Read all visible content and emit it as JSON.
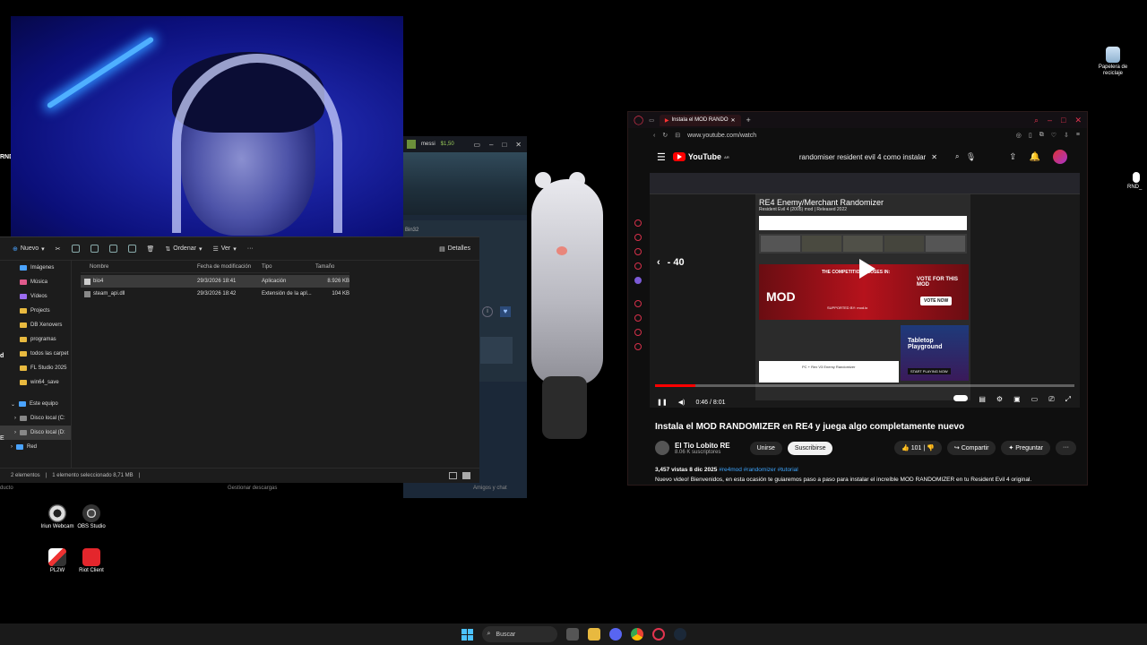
{
  "desktop": {
    "recycle_bin": "Papelera de reciclaje",
    "rnd_label": "RND_",
    "icons": [
      {
        "label": "Iriun Webcam"
      },
      {
        "label": "OBS Studio"
      },
      {
        "label": "PL2W"
      },
      {
        "label": "Riot Client"
      }
    ]
  },
  "explorer": {
    "toolbar": {
      "new": "Nuevo",
      "sort": "Ordenar",
      "view": "Ver",
      "more": "···",
      "details": "Detalles"
    },
    "left_edge_text": [
      "RND",
      "d",
      "E",
      "ducto"
    ],
    "sidebar": [
      {
        "label": "Imágenes"
      },
      {
        "label": "Música"
      },
      {
        "label": "Vídeos"
      },
      {
        "label": "Projects"
      },
      {
        "label": "DB Xenovers"
      },
      {
        "label": "programas"
      },
      {
        "label": "todos las carpet"
      },
      {
        "label": "FL Studio 2025"
      },
      {
        "label": "win64_save"
      },
      {
        "label": "Este equipo"
      },
      {
        "label": "Disco local (C:"
      },
      {
        "label": "Disco local (D:"
      },
      {
        "label": "Red"
      }
    ],
    "columns": [
      "Nombre",
      "Fecha de modificación",
      "Tipo",
      "Tamaño"
    ],
    "rows": [
      {
        "name": "bio4",
        "date": "29/3/2026 18:41",
        "type": "Aplicación",
        "size": "8.926 KB"
      },
      {
        "name": "steam_api.dll",
        "date": "29/3/2026 18:42",
        "type": "Extensión de la apl...",
        "size": "104 KB"
      }
    ],
    "status": {
      "count": "2 elementos",
      "selected": "1 elemento seleccionado 8,71 MB"
    },
    "search_fragment": "Bin32"
  },
  "steam": {
    "user": "messi",
    "balance": "$1,50",
    "manage_downloads": "Gestionar descargas",
    "friends_chat": "Amigos y chat"
  },
  "browser": {
    "tab_title": "Instala el MOD RANDO",
    "url": "www.youtube.com/watch",
    "search_value": "randomiser resident evil 4 como instalar",
    "logo": "YouTube",
    "logo_suffix": "AR",
    "video": {
      "page_title": "RE4 Enemy/Merchant Randomizer",
      "page_subtitle": "Resident Evil 4 (2005) mod | Released 2022",
      "banner_text": "THE COMPETITION CLOSES IN:",
      "banner_mod": "MOD",
      "banner_cta": "VOTE FOR THIS MOD",
      "banner_vote": "VOTE NOW",
      "banner_support": "SUPPORTED BY: mod.io",
      "seek": "- 40",
      "time": "0:46 / 8:01",
      "progress_fraction": 0.096,
      "side_ad": "Tabletop Playground",
      "side_ad_cta": "START PLAYING NOW",
      "file_item": "PC + Rex V3 Enemy Randomizer"
    },
    "video_title": "Instala el MOD RANDOMIZER en RE4 y juega algo completamente nuevo",
    "channel": {
      "name": "El Tio Lobito RE",
      "subs": "8.06 K suscriptores",
      "join": "Unirse",
      "subscribe": "Suscribirse",
      "likes": "101",
      "share": "Compartir",
      "ask": "Preguntar",
      "more": "···"
    },
    "description": {
      "meta": "3,457 vistas  8 dic 2025",
      "tags": "#re4mod #randomizer #tutorial",
      "text": "Nuevo video! Bienvenidos, en esta ocasión te guiaremos  paso a paso  para instalar el increíble MOD RANDOMIZER en tu Resident Evil 4 original."
    }
  },
  "taskbar": {
    "search": "Buscar"
  },
  "colors": {
    "accent_red": "#e2344f",
    "yt_red": "#ff0000",
    "folder": "#e8b93f",
    "link": "#3ea6ff"
  }
}
